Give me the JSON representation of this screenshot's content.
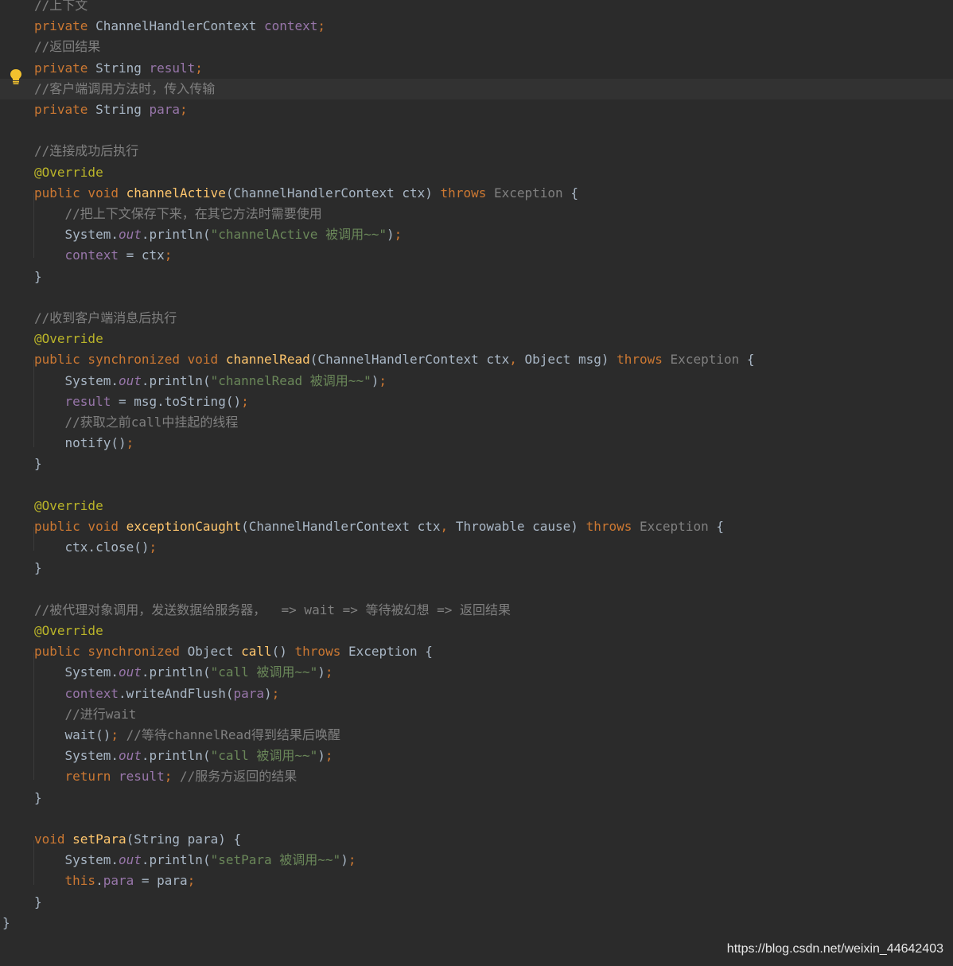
{
  "editor": {
    "lines": [
      [
        {
          "t": "//上下文",
          "c": "cm"
        }
      ],
      [
        {
          "t": "private ",
          "c": "kw"
        },
        {
          "t": "ChannelHandlerContext ",
          "c": "pl"
        },
        {
          "t": "context",
          "c": "fld"
        },
        {
          "t": ";",
          "c": "kw"
        }
      ],
      [
        {
          "t": "//返回结果",
          "c": "cm"
        }
      ],
      [
        {
          "t": "private ",
          "c": "kw"
        },
        {
          "t": "String ",
          "c": "pl"
        },
        {
          "t": "result",
          "c": "fld"
        },
        {
          "t": ";",
          "c": "kw"
        }
      ],
      [
        {
          "t": "//客户端调用方法时，传入传输",
          "c": "cm"
        }
      ],
      [
        {
          "t": "private ",
          "c": "kw"
        },
        {
          "t": "String ",
          "c": "pl"
        },
        {
          "t": "para",
          "c": "fld"
        },
        {
          "t": ";",
          "c": "kw"
        }
      ],
      [],
      [
        {
          "t": "//连接成功后执行",
          "c": "cm"
        }
      ],
      [
        {
          "t": "@Override",
          "c": "ann"
        }
      ],
      [
        {
          "t": "public void ",
          "c": "kw"
        },
        {
          "t": "channelActive",
          "c": "fn"
        },
        {
          "t": "(ChannelHandlerContext ctx) ",
          "c": "pl"
        },
        {
          "t": "throws ",
          "c": "kw"
        },
        {
          "t": "Exception",
          "c": "exc"
        },
        {
          "t": " {",
          "c": "pl"
        }
      ],
      [
        {
          "t": "    //把上下文保存下来，在其它方法时需要使用",
          "c": "cm"
        }
      ],
      [
        {
          "t": "    System.",
          "c": "pl"
        },
        {
          "t": "out",
          "c": "stat"
        },
        {
          "t": ".println(",
          "c": "pl"
        },
        {
          "t": "\"channelActive 被调用~~\"",
          "c": "str"
        },
        {
          "t": ")",
          "c": "pl"
        },
        {
          "t": ";",
          "c": "kw"
        }
      ],
      [
        {
          "t": "    ",
          "c": "pl"
        },
        {
          "t": "context",
          "c": "fld"
        },
        {
          "t": " = ctx",
          "c": "pl"
        },
        {
          "t": ";",
          "c": "kw"
        }
      ],
      [
        {
          "t": "}",
          "c": "pl"
        }
      ],
      [],
      [
        {
          "t": "//收到客户端消息后执行",
          "c": "cm"
        }
      ],
      [
        {
          "t": "@Override",
          "c": "ann"
        }
      ],
      [
        {
          "t": "public synchronized void ",
          "c": "kw"
        },
        {
          "t": "channelRead",
          "c": "fn"
        },
        {
          "t": "(ChannelHandlerContext ctx",
          "c": "pl"
        },
        {
          "t": ", ",
          "c": "kw"
        },
        {
          "t": "Object msg) ",
          "c": "pl"
        },
        {
          "t": "throws ",
          "c": "kw"
        },
        {
          "t": "Exception",
          "c": "exc"
        },
        {
          "t": " {",
          "c": "pl"
        }
      ],
      [
        {
          "t": "    System.",
          "c": "pl"
        },
        {
          "t": "out",
          "c": "stat"
        },
        {
          "t": ".println(",
          "c": "pl"
        },
        {
          "t": "\"channelRead 被调用~~\"",
          "c": "str"
        },
        {
          "t": ")",
          "c": "pl"
        },
        {
          "t": ";",
          "c": "kw"
        }
      ],
      [
        {
          "t": "    ",
          "c": "pl"
        },
        {
          "t": "result",
          "c": "fld"
        },
        {
          "t": " = msg.toString()",
          "c": "pl"
        },
        {
          "t": ";",
          "c": "kw"
        }
      ],
      [
        {
          "t": "    //获取之前call中挂起的线程",
          "c": "cm"
        }
      ],
      [
        {
          "t": "    notify()",
          "c": "pl"
        },
        {
          "t": ";",
          "c": "kw"
        }
      ],
      [
        {
          "t": "}",
          "c": "pl"
        }
      ],
      [],
      [
        {
          "t": "@Override",
          "c": "ann"
        }
      ],
      [
        {
          "t": "public void ",
          "c": "kw"
        },
        {
          "t": "exceptionCaught",
          "c": "fn"
        },
        {
          "t": "(ChannelHandlerContext ctx",
          "c": "pl"
        },
        {
          "t": ", ",
          "c": "kw"
        },
        {
          "t": "Throwable cause) ",
          "c": "pl"
        },
        {
          "t": "throws ",
          "c": "kw"
        },
        {
          "t": "Exception",
          "c": "exc"
        },
        {
          "t": " {",
          "c": "pl"
        }
      ],
      [
        {
          "t": "    ctx.close()",
          "c": "pl"
        },
        {
          "t": ";",
          "c": "kw"
        }
      ],
      [
        {
          "t": "}",
          "c": "pl"
        }
      ],
      [],
      [
        {
          "t": "//被代理对象调用，发送数据给服务器，  => wait => 等待被幻想 => 返回结果",
          "c": "cm"
        }
      ],
      [
        {
          "t": "@Override",
          "c": "ann"
        }
      ],
      [
        {
          "t": "public synchronized ",
          "c": "kw"
        },
        {
          "t": "Object ",
          "c": "pl"
        },
        {
          "t": "call",
          "c": "fn"
        },
        {
          "t": "() ",
          "c": "pl"
        },
        {
          "t": "throws ",
          "c": "kw"
        },
        {
          "t": "Exception {",
          "c": "pl"
        }
      ],
      [
        {
          "t": "    System.",
          "c": "pl"
        },
        {
          "t": "out",
          "c": "stat"
        },
        {
          "t": ".println(",
          "c": "pl"
        },
        {
          "t": "\"call 被调用~~\"",
          "c": "str"
        },
        {
          "t": ")",
          "c": "pl"
        },
        {
          "t": ";",
          "c": "kw"
        }
      ],
      [
        {
          "t": "    ",
          "c": "pl"
        },
        {
          "t": "context",
          "c": "fld"
        },
        {
          "t": ".writeAndFlush(",
          "c": "pl"
        },
        {
          "t": "para",
          "c": "fld"
        },
        {
          "t": ")",
          "c": "pl"
        },
        {
          "t": ";",
          "c": "kw"
        }
      ],
      [
        {
          "t": "    //进行wait",
          "c": "cm"
        }
      ],
      [
        {
          "t": "    wait()",
          "c": "pl"
        },
        {
          "t": "; ",
          "c": "kw"
        },
        {
          "t": "//等待channelRead得到结果后唤醒",
          "c": "cm"
        }
      ],
      [
        {
          "t": "    System.",
          "c": "pl"
        },
        {
          "t": "out",
          "c": "stat"
        },
        {
          "t": ".println(",
          "c": "pl"
        },
        {
          "t": "\"call 被调用~~\"",
          "c": "str"
        },
        {
          "t": ")",
          "c": "pl"
        },
        {
          "t": ";",
          "c": "kw"
        }
      ],
      [
        {
          "t": "    return ",
          "c": "kw"
        },
        {
          "t": "result",
          "c": "fld"
        },
        {
          "t": "; ",
          "c": "kw"
        },
        {
          "t": "//服务方返回的结果",
          "c": "cm"
        }
      ],
      [
        {
          "t": "}",
          "c": "pl"
        }
      ],
      [],
      [
        {
          "t": "void ",
          "c": "kw"
        },
        {
          "t": "setPara",
          "c": "fn"
        },
        {
          "t": "(String para) {",
          "c": "pl"
        }
      ],
      [
        {
          "t": "    System.",
          "c": "pl"
        },
        {
          "t": "out",
          "c": "stat"
        },
        {
          "t": ".println(",
          "c": "pl"
        },
        {
          "t": "\"setPara 被调用~~\"",
          "c": "str"
        },
        {
          "t": ")",
          "c": "pl"
        },
        {
          "t": ";",
          "c": "kw"
        }
      ],
      [
        {
          "t": "    this",
          "c": "kw"
        },
        {
          "t": ".",
          "c": "pl"
        },
        {
          "t": "para",
          "c": "fld"
        },
        {
          "t": " = para",
          "c": "pl"
        },
        {
          "t": ";",
          "c": "kw"
        }
      ],
      [
        {
          "t": "}",
          "c": "pl"
        }
      ],
      [
        {
          "t": "}",
          "c": "pl"
        }
      ]
    ],
    "highlighted_line": 4,
    "intention_icon": "lightbulb-icon"
  },
  "watermark": "https://blog.csdn.net/weixin_44642403"
}
